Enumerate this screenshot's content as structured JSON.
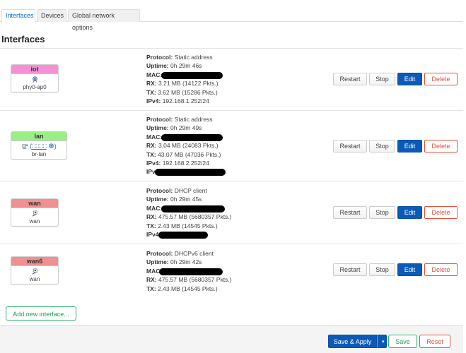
{
  "tabs": [
    {
      "label": "Interfaces",
      "active": true
    },
    {
      "label": "Devices",
      "active": false
    },
    {
      "label": "Global network options",
      "active": false
    }
  ],
  "section_title": "Interfaces",
  "labels": {
    "protocol": "Protocol:",
    "uptime": "Uptime:",
    "mac": "MAC:",
    "rx": "RX:",
    "tx": "TX:",
    "ipv4": "IPv4:",
    "ipv6_partial": "IPv",
    "ipv4_partial": "IPv4",
    "mac_partial": "MAC"
  },
  "actions": {
    "restart": "Restart",
    "stop": "Stop",
    "edit": "Edit",
    "delete": "Delete"
  },
  "interfaces": [
    {
      "name": "iot",
      "color": "#f78fd6",
      "device": "phy0-ap0",
      "icon": "wifi-icon",
      "protocol": "Static address",
      "uptime": "0h 29m 46s",
      "mac": "[redacted]",
      "rx": "3.21 MB (14122 Pkts.)",
      "tx": "3.62 MB (15286 Pkts.)",
      "ipv4": "192.168.1.252/24"
    },
    {
      "name": "lan",
      "color": "#99ee88",
      "device": "br-lan",
      "icon": "bridge-icon",
      "icons_text": "(∷∷∷∷)",
      "protocol": "Static address",
      "uptime": "0h 29m 49s",
      "mac": "[redacted]",
      "rx": "3.04 MB (24083 Pkts.)",
      "tx": "43.07 MB (47036 Pkts.)",
      "ipv4": "192.168.2.252/24",
      "ipv6": "[redacted]"
    },
    {
      "name": "wan",
      "color": "#f09090",
      "device": "wan",
      "icon": "ethernet-port-icon",
      "protocol": "DHCP client",
      "uptime": "0h 29m 45s",
      "mac": "[redacted]",
      "rx": "475.57 MB (5680357 Pkts.)",
      "tx": "2.43 MB (14545 Pkts.)",
      "ipv4": "[redacted]"
    },
    {
      "name": "wan6",
      "color": "#f09090",
      "device": "wan",
      "icon": "ethernet-port-icon",
      "protocol": "DHCPv6 client",
      "uptime": "0h 29m 42s",
      "mac": "[redacted]",
      "rx": "475.57 MB (5680357 Pkts.)",
      "tx": "2.43 MB (14545 Pkts.)"
    }
  ],
  "add_interface": "Add new interface...",
  "footer": {
    "save_apply": "Save & Apply",
    "dropdown": "▾",
    "save": "Save",
    "reset": "Reset"
  }
}
